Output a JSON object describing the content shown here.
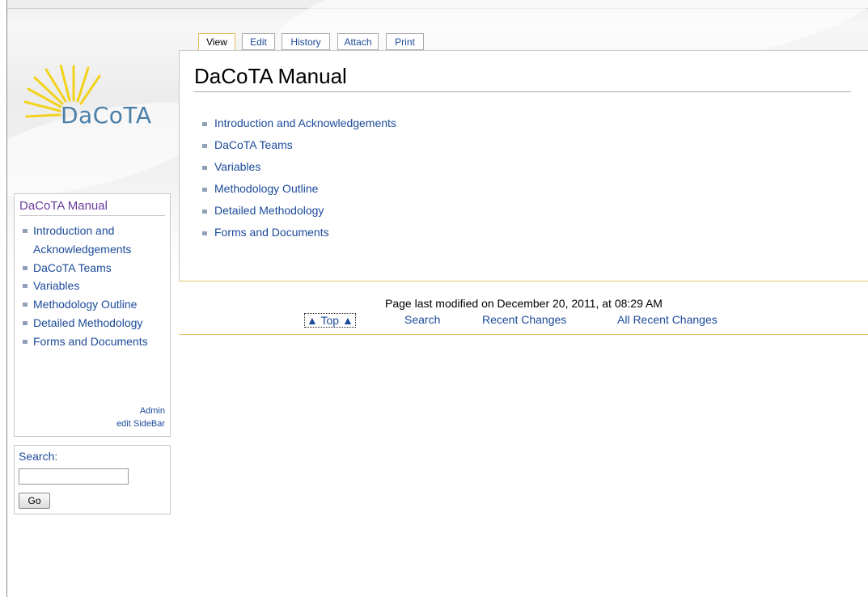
{
  "logo": {
    "text": "DaCoTA"
  },
  "tabs": [
    {
      "label": "View",
      "active": true
    },
    {
      "label": "Edit"
    },
    {
      "label": "History"
    },
    {
      "label": "Attach"
    },
    {
      "label": "Print"
    }
  ],
  "page": {
    "title": "DaCoTA Manual",
    "links": [
      "Introduction and Acknowledgements",
      "DaCoTA Teams",
      "Variables",
      "Methodology Outline",
      "Detailed Methodology",
      "Forms and Documents"
    ]
  },
  "sidebar": {
    "title": "DaCoTA Manual",
    "items": [
      "Introduction and Acknowledgements",
      "DaCoTA Teams",
      "Variables",
      "Methodology Outline",
      "Detailed Methodology",
      "Forms and Documents"
    ],
    "admin_label": "Admin",
    "edit_sidebar_label": "edit SideBar"
  },
  "search": {
    "label": "Search:",
    "value": "",
    "button": "Go"
  },
  "footer": {
    "modified": "Page last modified on December 20, 2011, at 08:29 AM",
    "top_link": "▲ Top ▲",
    "search_link": "Search",
    "recent_changes": "Recent Changes",
    "all_recent_changes": "All Recent Changes"
  },
  "colors": {
    "link": "#1c4a9a",
    "sidebar_title": "#6b3a9e",
    "logo_rays": "#f2d21c",
    "logo_text": "#4a7fa8",
    "footer_border": "#e5c56a"
  }
}
